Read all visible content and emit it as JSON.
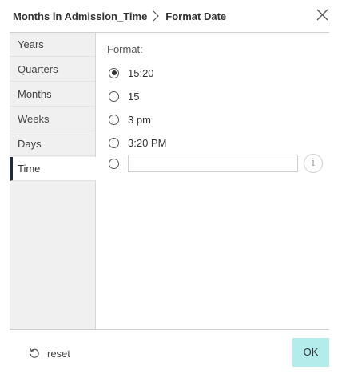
{
  "header": {
    "parent_title": "Months in Admission_Time",
    "title": "Format Date"
  },
  "sidebar": {
    "items": [
      {
        "label": "Years"
      },
      {
        "label": "Quarters"
      },
      {
        "label": "Months"
      },
      {
        "label": "Weeks"
      },
      {
        "label": "Days"
      },
      {
        "label": "Time"
      }
    ],
    "active": "Time"
  },
  "main": {
    "format_label": "Format:",
    "options": [
      {
        "label": "15:20",
        "checked": true
      },
      {
        "label": "15",
        "checked": false
      },
      {
        "label": "3 pm",
        "checked": false
      },
      {
        "label": "3:20 PM",
        "checked": false
      }
    ],
    "custom_format": {
      "value": "",
      "placeholder": ""
    },
    "info_glyph": "i"
  },
  "footer": {
    "reset_label": "reset",
    "ok_label": "OK"
  },
  "colors": {
    "ok_background": "#b4ecec",
    "active_indicator": "#222a35",
    "sidebar_background": "#f0f0f0"
  }
}
